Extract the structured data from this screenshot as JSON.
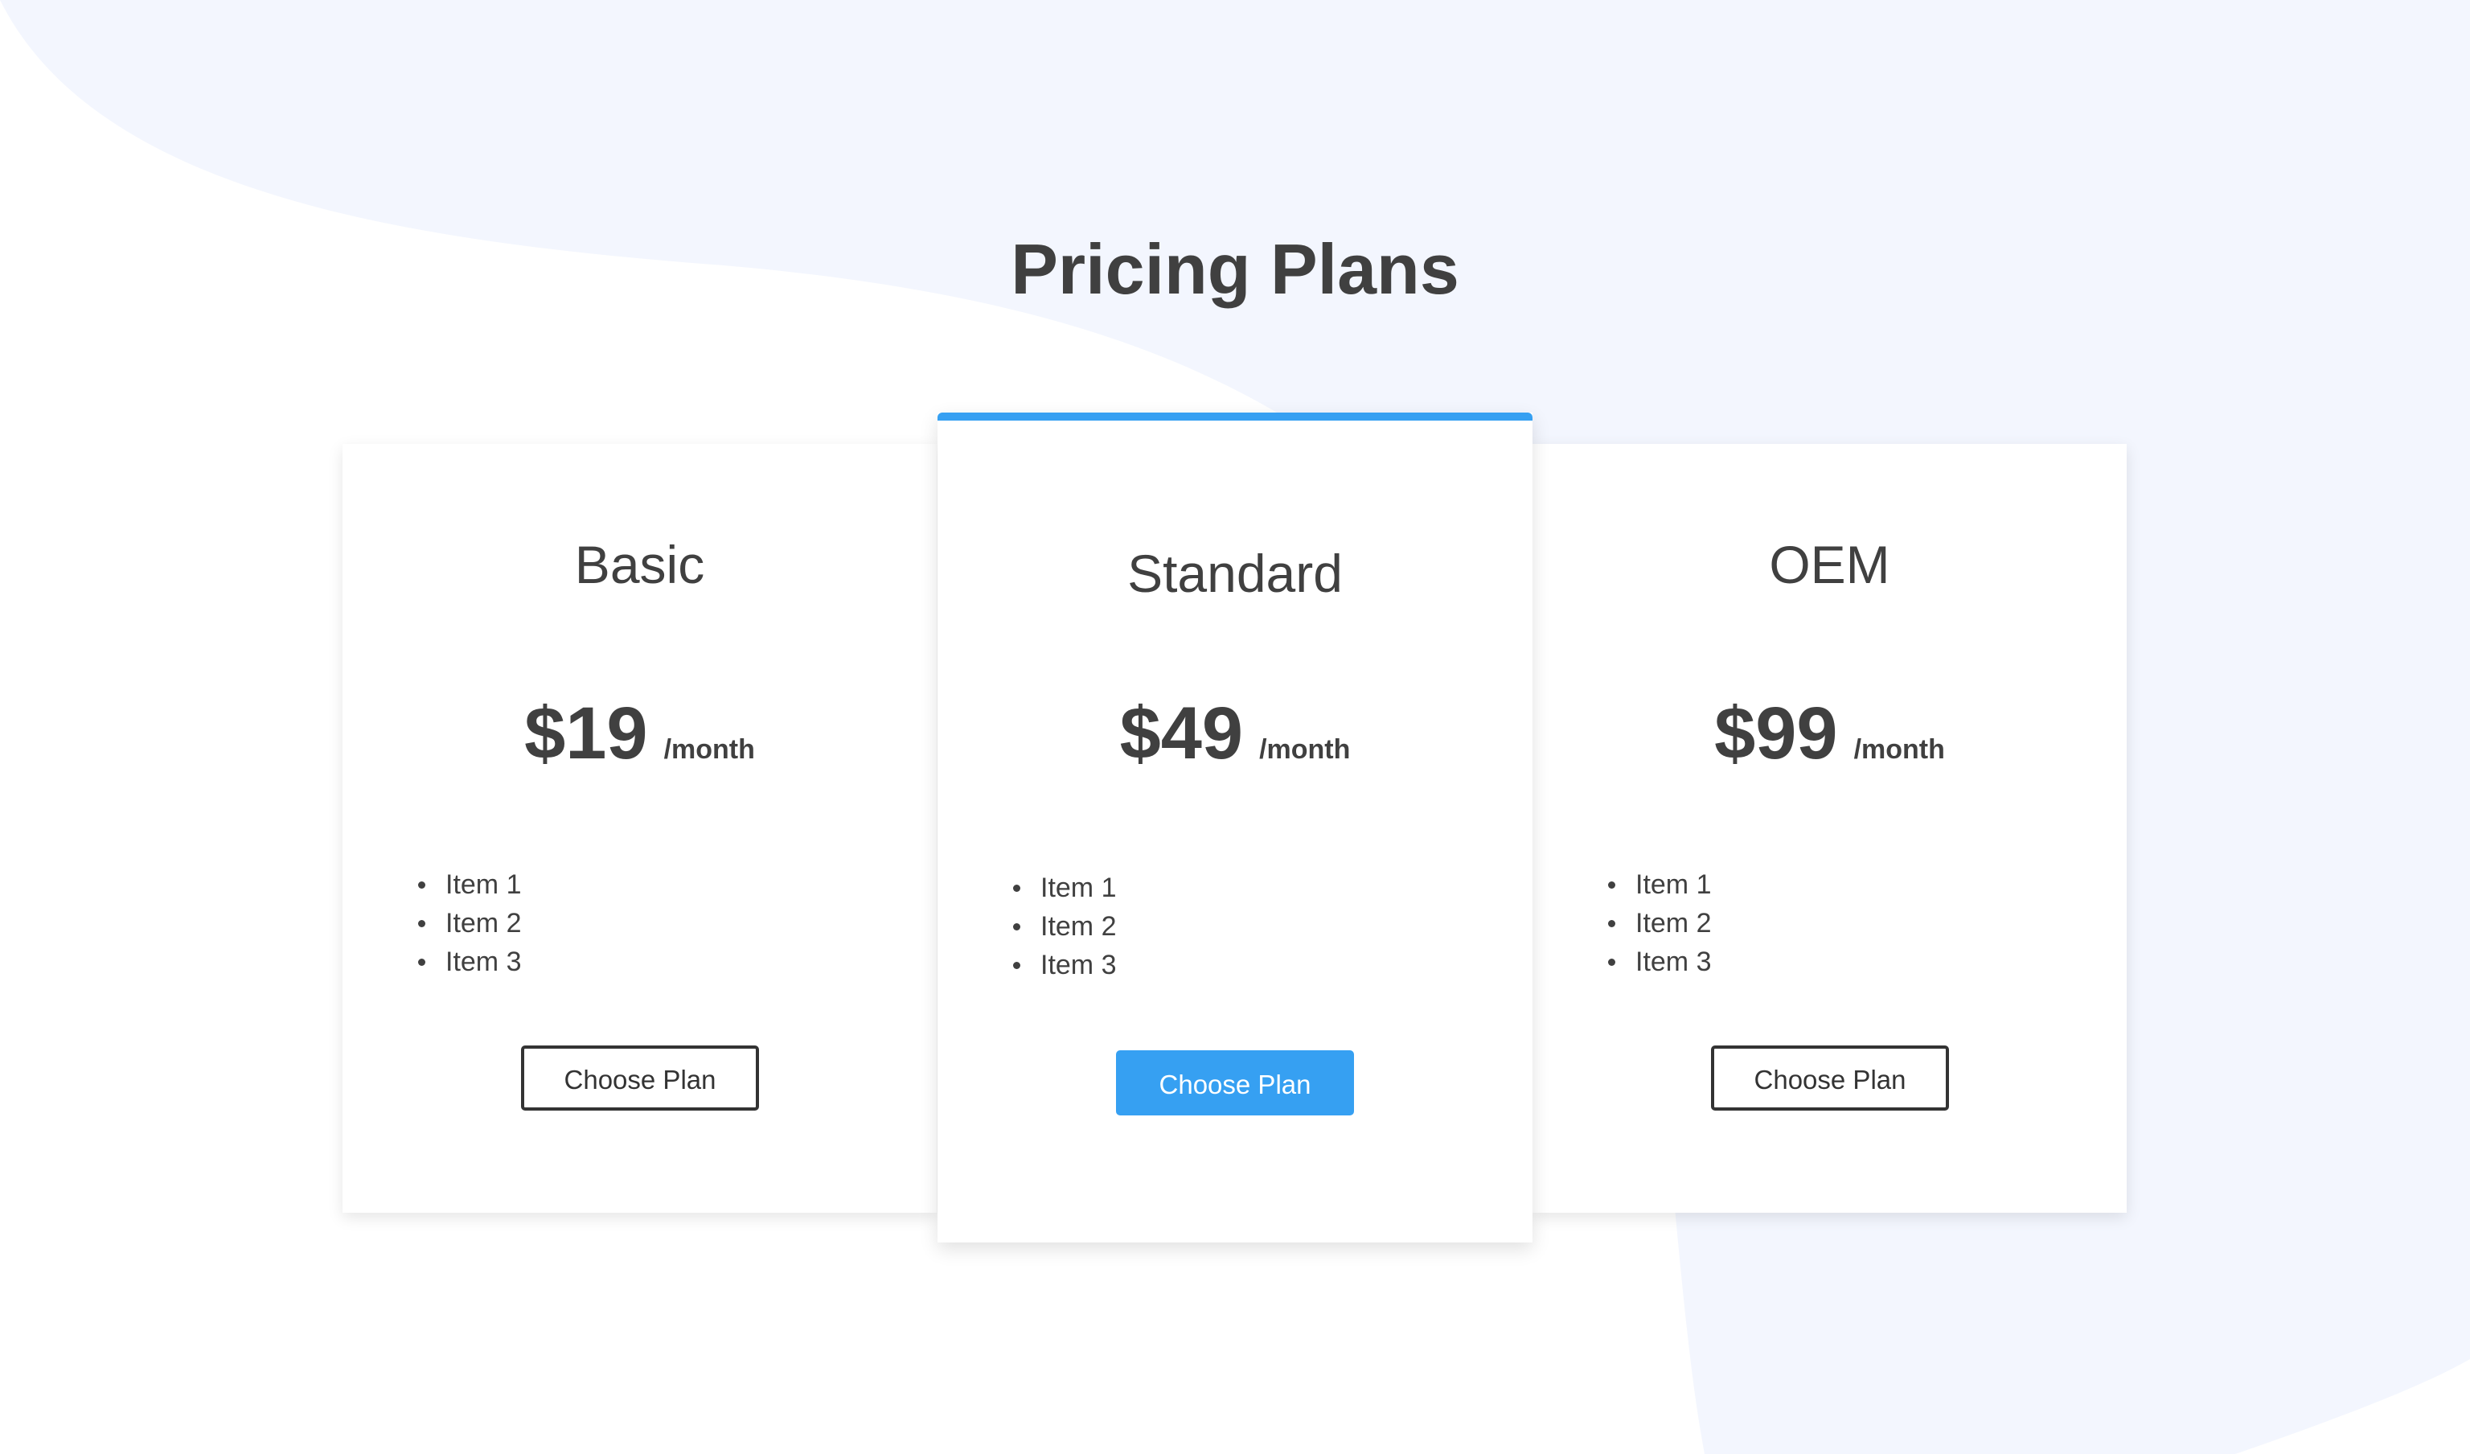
{
  "colors": {
    "accent": "#36a0f2",
    "text": "#404040",
    "background": "#ffffff",
    "background_shape": "#f3f6fe"
  },
  "page": {
    "title": "Pricing Plans"
  },
  "plans": [
    {
      "name": "Basic",
      "price": "$19",
      "period": "/month",
      "features": [
        "Item 1",
        "Item 2",
        "Item 3"
      ],
      "button_label": "Choose Plan",
      "featured": false
    },
    {
      "name": "Standard",
      "price": "$49",
      "period": "/month",
      "features": [
        "Item 1",
        "Item 2",
        "Item 3"
      ],
      "button_label": "Choose Plan",
      "featured": true
    },
    {
      "name": "OEM",
      "price": "$99",
      "period": "/month",
      "features": [
        "Item 1",
        "Item 2",
        "Item 3"
      ],
      "button_label": "Choose Plan",
      "featured": false
    }
  ]
}
